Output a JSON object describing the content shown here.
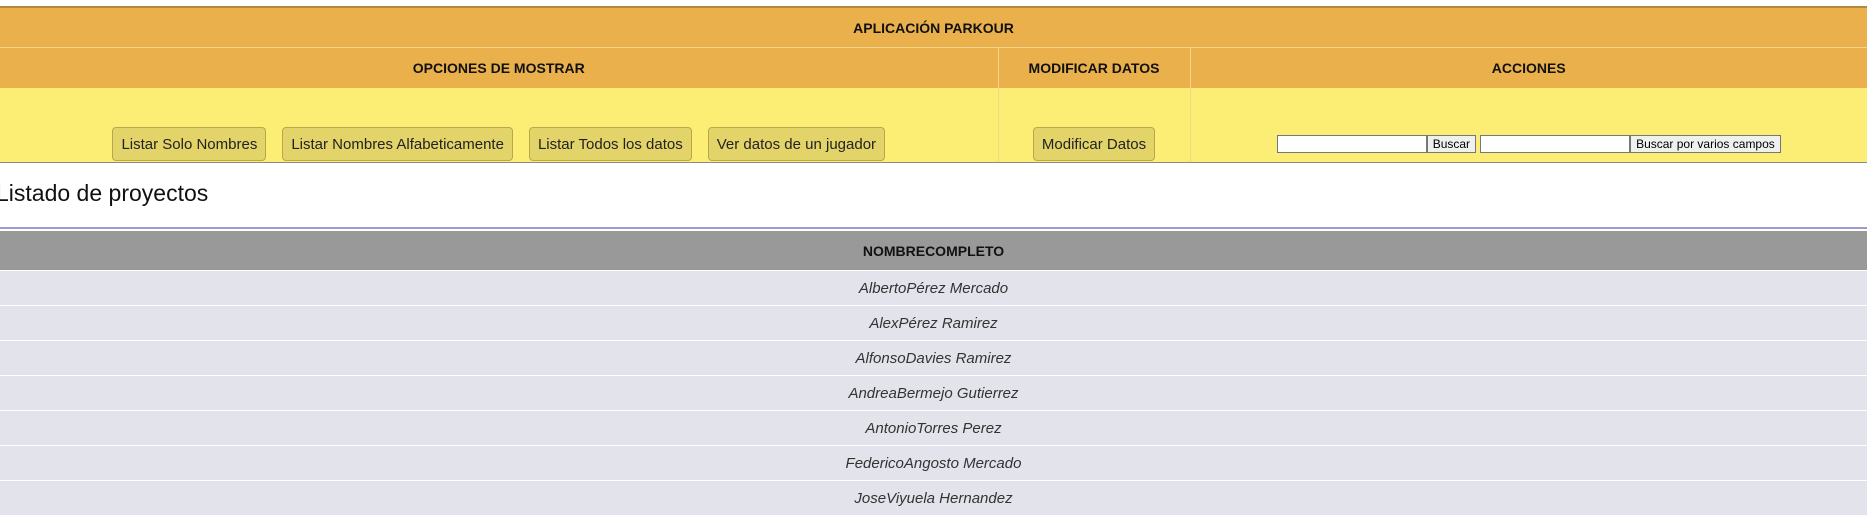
{
  "app": {
    "title": "APLICACIÓN PARKOUR"
  },
  "sections": {
    "show": {
      "title": "OPCIONES DE MOSTRAR",
      "buttons": [
        "Listar Solo Nombres",
        "Listar Nombres Alfabeticamente",
        "Listar Todos los datos",
        "Ver datos de un jugador"
      ]
    },
    "modify": {
      "title": "MODIFICAR DATOS",
      "button": "Modificar Datos"
    },
    "actions": {
      "title": "ACCIONES",
      "search_value": "",
      "search_button": "Buscar",
      "multi_search_value": "",
      "multi_search_button": "Buscar por varios campos"
    }
  },
  "listing": {
    "heading": "Listado de proyectos",
    "column": "NOMBRECOMPLETO",
    "rows": [
      "AlbertoPérez Mercado",
      "AlexPérez Ramirez",
      "AlfonsoDavies Ramirez",
      "AndreaBermejo Gutierrez",
      "AntonioTorres Perez",
      "FedericoAngosto Mercado",
      "JoseViyuela Hernandez"
    ]
  }
}
